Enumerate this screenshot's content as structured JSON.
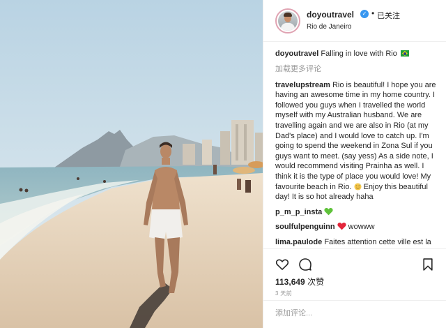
{
  "post": {
    "username": "doyoutravel",
    "verified_icon": "verified-badge-icon",
    "separator": "•",
    "follow_status": "已关注",
    "location": "Rio de Janeiro",
    "caption": {
      "username": "doyoutravel",
      "text": "Falling in love with Rio",
      "emoji": "brazil-flag-icon"
    },
    "load_more": "加载更多评论",
    "comments": [
      {
        "username": "travelupstream",
        "text": "Rio is beautiful! I hope you are having an awesome time in my home country. I followed you guys when I travelled the world myself with my Australian husband. We are travelling again and we are also in Rio (at my Dad's place) and I would love to catch up. I'm going to spend the weekend in Zona Sul if you guys want to meet. (say yess) As a side note, I would recommend visiting Prainha as well. I think it is the type of place you would love! My favourite beach in Rio.",
        "text_after_emoji": "Enjoy this beautiful day! It is so hot already haha"
      },
      {
        "username": "p_m_p_insta",
        "text": ""
      },
      {
        "username": "soulfulpenguinn",
        "text": "wowww"
      },
      {
        "username": "lima.paulode",
        "text": "Faites attention cette ville est la plus dangereuse au monde"
      }
    ],
    "likes_count": "113,649",
    "likes_label": "次赞",
    "time_ago": "3 天前",
    "add_comment_placeholder": "添加评论...",
    "colors": {
      "verified_blue": "#3897f0",
      "text_primary": "#262626",
      "text_secondary": "#999999",
      "heart_red": "#ed4956",
      "green_heart": "#5fc23a",
      "divider": "#efefef"
    }
  }
}
